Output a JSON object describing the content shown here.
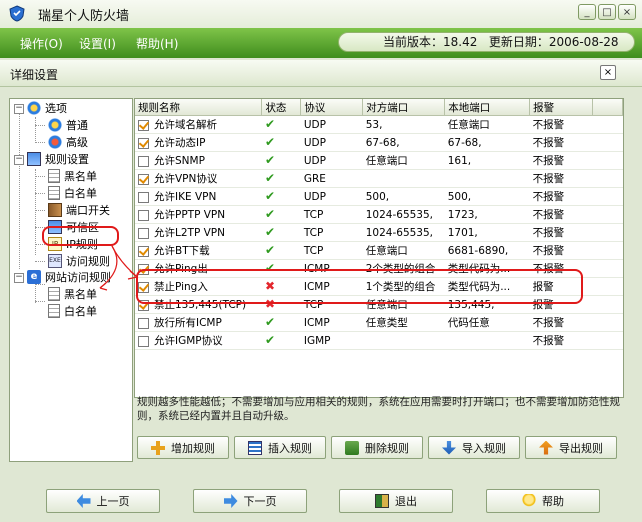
{
  "window": {
    "title": "瑞星个人防火墙",
    "min": "_",
    "max": "□",
    "close": "×"
  },
  "menu": [
    {
      "label": "操作(O)"
    },
    {
      "label": "设置(I)"
    },
    {
      "label": "帮助(H)"
    }
  ],
  "version": {
    "label_version": "当前版本：18.42",
    "label_date": "更新日期：2006-08-28"
  },
  "dialog": {
    "title": "详细设置",
    "close": "×"
  },
  "tree": {
    "options": "选项",
    "general": "普通",
    "advanced": "高级",
    "rules_settings": "规则设置",
    "blacklist": "黑名单",
    "whitelist": "白名单",
    "port_switch": "端口开关",
    "trusted_zone": "可信区",
    "ip_rules": "IP规则",
    "access_rules": "访问规则",
    "web_access_rules": "网站访问规则",
    "web_blacklist": "黑名单",
    "web_whitelist": "白名单"
  },
  "table": {
    "headers": [
      "规则名称",
      "状态",
      "协议",
      "对方端口",
      "本地端口",
      "报警"
    ],
    "rows": [
      {
        "checked": true,
        "name": "允许域名解析",
        "status": "ok",
        "protocol": "UDP",
        "remote_port": "53,",
        "local_port": "任意端口",
        "alarm": "不报警"
      },
      {
        "checked": true,
        "name": "允许动态IP",
        "status": "ok",
        "protocol": "UDP",
        "remote_port": "67-68,",
        "local_port": "67-68,",
        "alarm": "不报警"
      },
      {
        "checked": false,
        "name": "允许SNMP",
        "status": "ok",
        "protocol": "UDP",
        "remote_port": "任意端口",
        "local_port": "161,",
        "alarm": "不报警"
      },
      {
        "checked": true,
        "name": "允许VPN协议",
        "status": "ok",
        "protocol": "GRE",
        "remote_port": "",
        "local_port": "",
        "alarm": "不报警"
      },
      {
        "checked": false,
        "name": "允许IKE VPN",
        "status": "ok",
        "protocol": "UDP",
        "remote_port": "500,",
        "local_port": "500,",
        "alarm": "不报警"
      },
      {
        "checked": false,
        "name": "允许PPTP VPN",
        "status": "ok",
        "protocol": "TCP",
        "remote_port": "1024-65535,",
        "local_port": "1723,",
        "alarm": "不报警"
      },
      {
        "checked": false,
        "name": "允许L2TP VPN",
        "status": "ok",
        "protocol": "TCP",
        "remote_port": "1024-65535,",
        "local_port": "1701,",
        "alarm": "不报警"
      },
      {
        "checked": true,
        "name": "允许BT下载",
        "status": "ok",
        "protocol": "TCP",
        "remote_port": "任意端口",
        "local_port": "6681-6890,",
        "alarm": "不报警"
      },
      {
        "checked": true,
        "name": "允许Ping出",
        "status": "ok",
        "protocol": "ICMP",
        "remote_port": "2个类型的组合",
        "local_port": "类型代码为...",
        "alarm": "不报警"
      },
      {
        "checked": true,
        "name": "禁止Ping入",
        "status": "no",
        "protocol": "ICMP",
        "remote_port": "1个类型的组合",
        "local_port": "类型代码为...",
        "alarm": "报警"
      },
      {
        "checked": true,
        "name": "禁止135,445(TCP)",
        "status": "no",
        "protocol": "TCP",
        "remote_port": "任意端口",
        "local_port": "135,445,",
        "alarm": "报警"
      },
      {
        "checked": false,
        "name": "放行所有ICMP",
        "status": "ok",
        "protocol": "ICMP",
        "remote_port": "任意类型",
        "local_port": "代码任意",
        "alarm": "不报警"
      },
      {
        "checked": false,
        "name": "允许IGMP协议",
        "status": "ok",
        "protocol": "IGMP",
        "remote_port": "",
        "local_port": "",
        "alarm": "不报警"
      }
    ]
  },
  "description": "规则越多性能越低；不需要增加与应用相关的规则，系统在应用需要时打开端口；也不需要增加防范性规则，系统已经内置并且自动升级。",
  "actions": {
    "add": "增加规则",
    "insert": "插入规则",
    "delete": "删除规则",
    "import": "导入规则",
    "export": "导出规则"
  },
  "footer": {
    "prev": "上一页",
    "next": "下一页",
    "exit": "退出",
    "help": "帮助"
  },
  "colors": {
    "accent_green": "#3f8d1d",
    "annotation_red": "#e01a1a"
  }
}
